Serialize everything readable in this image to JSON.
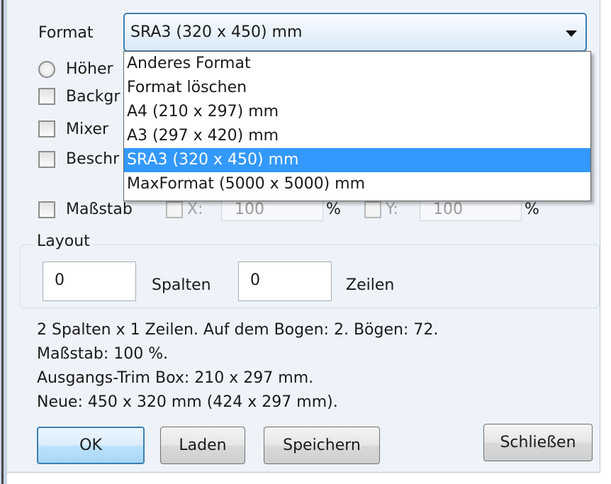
{
  "format": {
    "label": "Format",
    "selected": "SRA3 (320 x 450) mm",
    "options": [
      "Anderes Format",
      "Format löschen",
      "A4 (210 x 297) mm",
      "A3 (297 x 420) mm",
      "SRA3 (320 x 450) mm",
      "MaxFormat (5000 x 5000) mm"
    ],
    "highlighted_index": 4
  },
  "options": {
    "orientation_label": "Höher",
    "background_label": "Backgr",
    "mixer_label": "Mixer",
    "crop_label": "Beschr"
  },
  "scale": {
    "label": "Maßstab",
    "x_label": "X:",
    "x_value": "100",
    "x_unit": "%",
    "y_label": "Y:",
    "y_value": "100",
    "y_unit": "%"
  },
  "layout": {
    "title": "Layout",
    "columns_value": "0",
    "columns_label": "Spalten",
    "rows_value": "0",
    "rows_label": "Zeilen"
  },
  "info": {
    "line1": "2 Spalten x 1 Zeilen. Auf dem Bogen: 2. Bögen: 72.",
    "line2": "Maßstab: 100 %.",
    "line3": "Ausgangs-Trim Box: 210 x 297 mm.",
    "line4": "Neue: 450 x 320 mm (424 x 297 mm)."
  },
  "buttons": {
    "ok": "OK",
    "load": "Laden",
    "save": "Speichern",
    "close": "Schließen"
  }
}
